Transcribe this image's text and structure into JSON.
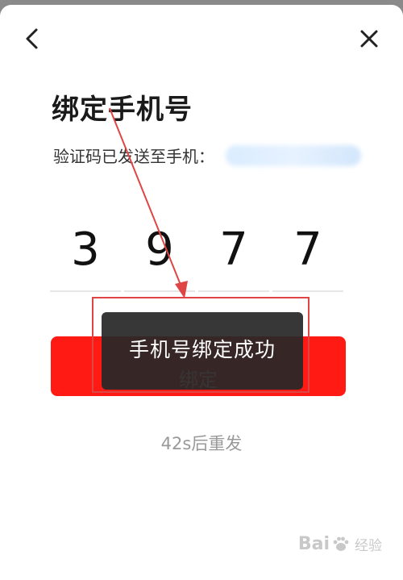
{
  "header": {
    "back_icon": "chevron-left-icon",
    "close_icon": "close-icon"
  },
  "page": {
    "title": "绑定手机号",
    "subtitle": "验证码已发送至手机："
  },
  "code": {
    "digits": [
      "3",
      "9",
      "7",
      "7"
    ]
  },
  "actions": {
    "bind_label": "绑定",
    "resend_text": "42s后重发"
  },
  "toast": {
    "message": "手机号绑定成功"
  },
  "watermark": {
    "brand_left": "Bai",
    "brand_right": "经验",
    "brand_mid_icon": "paw-icon"
  },
  "colors": {
    "primary": "#ff1a14",
    "annotation": "#e04545",
    "toast_bg": "#282828"
  }
}
